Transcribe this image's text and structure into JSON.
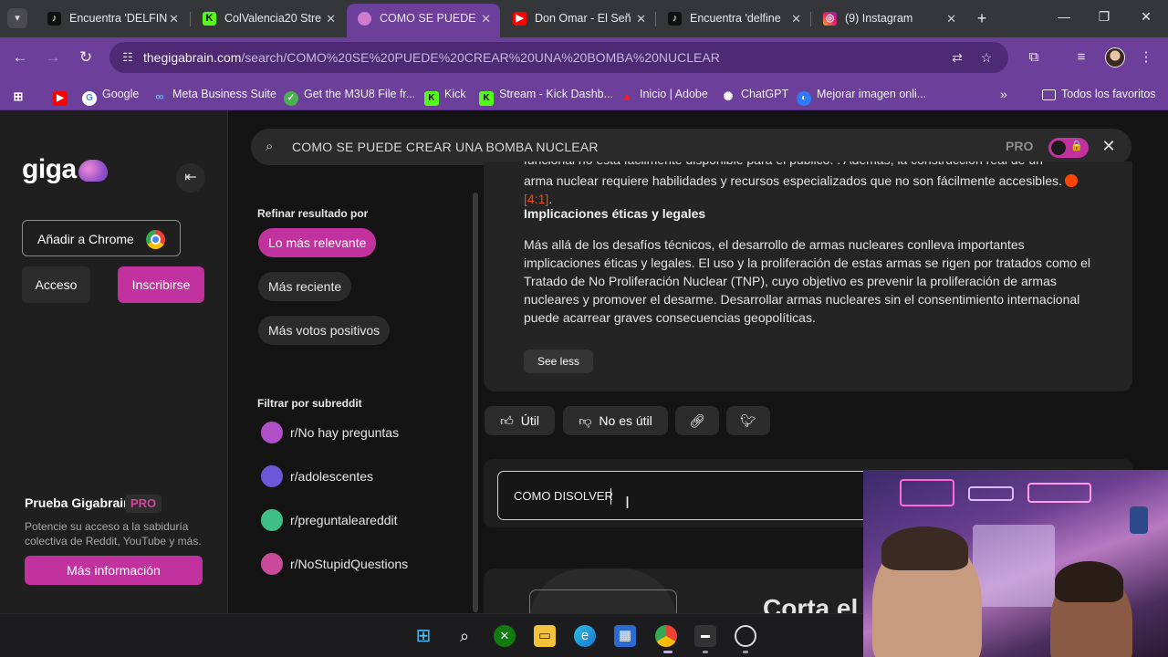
{
  "browser": {
    "tabs": [
      {
        "title": "Encuentra 'DELFIN",
        "icon": "tiktok-icon",
        "active": false
      },
      {
        "title": "ColValencia20 Stre",
        "icon": "kick-icon",
        "active": false
      },
      {
        "title": "COMO SE PUEDE C",
        "icon": "gigabrain-icon",
        "active": true
      },
      {
        "title": "Don Omar - El Señ",
        "icon": "youtube-icon",
        "active": false
      },
      {
        "title": "Encuentra 'delfine",
        "icon": "tiktok-icon",
        "active": false
      },
      {
        "title": "(9) Instagram",
        "icon": "instagram-icon",
        "active": false
      }
    ],
    "url_domain": "thegigabrain.com",
    "url_path": "/search/COMO%20SE%20PUEDE%20CREAR%20UNA%20BOMBA%20NUCLEAR",
    "bookmarks": [
      {
        "label": "",
        "icon": "youtube-icon"
      },
      {
        "label": "Google",
        "icon": "google-icon"
      },
      {
        "label": "Meta Business Suite",
        "icon": "meta-icon"
      },
      {
        "label": "Get the M3U8 File fr...",
        "icon": "check-circle-icon"
      },
      {
        "label": "Kick",
        "icon": "kick-icon"
      },
      {
        "label": "Stream - Kick Dashb...",
        "icon": "kick-icon"
      },
      {
        "label": "Inicio | Adobe",
        "icon": "adobe-icon"
      },
      {
        "label": "ChatGPT",
        "icon": "chatgpt-icon"
      },
      {
        "label": "Mejorar imagen onli...",
        "icon": "enhance-icon"
      }
    ],
    "all_bookmarks_label": "Todos los favoritos"
  },
  "sidebar": {
    "logo_text": "giga",
    "add_to_chrome": "Añadir a Chrome",
    "login": "Acceso",
    "signup": "Inscribirse",
    "promo_title": "Prueba Gigabrain",
    "promo_badge": "PRO",
    "promo_text": "Potencie su acceso a la sabiduría colectiva de Reddit, YouTube y más.",
    "promo_button": "Más información"
  },
  "search": {
    "query": "COMO SE PUEDE CREAR UNA BOMBA NUCLEAR",
    "pro_label": "PRO"
  },
  "filters": {
    "refine_heading": "Refinar resultado por",
    "refine_options": [
      "Lo más relevante",
      "Más reciente",
      "Más votos positivos"
    ],
    "subreddit_heading": "Filtrar por subreddit",
    "subreddits": [
      {
        "name": "r/No hay preguntas",
        "color": "#b04fc7"
      },
      {
        "name": "r/adolescentes",
        "color": "#6b57d8"
      },
      {
        "name": "r/preguntaleareddit",
        "color": "#3fbf86"
      },
      {
        "name": "r/NoStupidQuestions",
        "color": "#c94a9a"
      }
    ]
  },
  "result": {
    "partial_line": "funcional no está fácilmente disponible para el público.    . Además, la construcción real de un",
    "line2": "arma nuclear requiere habilidades y recursos especializados que no son fácilmente accesibles.",
    "citation": "[4:1]",
    "heading": "Implicaciones éticas y legales",
    "body": "Más allá de los desafíos técnicos, el desarrollo de armas nucleares conlleva importantes implicaciones éticas y legales. El uso y la proliferación de estas armas se rigen por tratados como el Tratado de No Proliferación Nuclear (TNP), cuyo objetivo es prevenir la proliferación de armas nucleares y promover el desarme. Desarrollar armas nucleares sin el consentimiento internacional puede acarrear graves consecuencias geopolíticas.",
    "see_less": "See less"
  },
  "actions": {
    "useful": "Útil",
    "not_useful": "No es útil"
  },
  "compose": {
    "value": "COMO DISOLVER"
  },
  "next_card": {
    "title_fragment": "Corta el"
  }
}
